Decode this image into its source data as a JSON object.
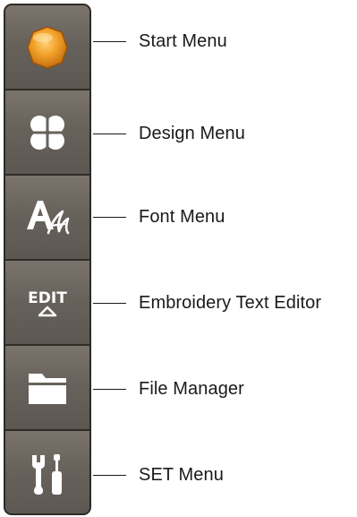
{
  "menus": [
    {
      "label": "Start Menu",
      "icon": "start-orb-icon"
    },
    {
      "label": "Design Menu",
      "icon": "four-petal-design-icon"
    },
    {
      "label": "Font Menu",
      "icon": "font-letters-icon"
    },
    {
      "label": "Embroidery Text Editor",
      "icon": "edit-text-icon",
      "icon_text": "EDIT"
    },
    {
      "label": "File Manager",
      "icon": "folder-icon"
    },
    {
      "label": "SET Menu",
      "icon": "wrench-screwdriver-icon"
    }
  ],
  "colors": {
    "panel": "#67625c",
    "panel_border": "#2d2a26",
    "icon": "#ffffff",
    "start_orb": "#f2a12a"
  }
}
